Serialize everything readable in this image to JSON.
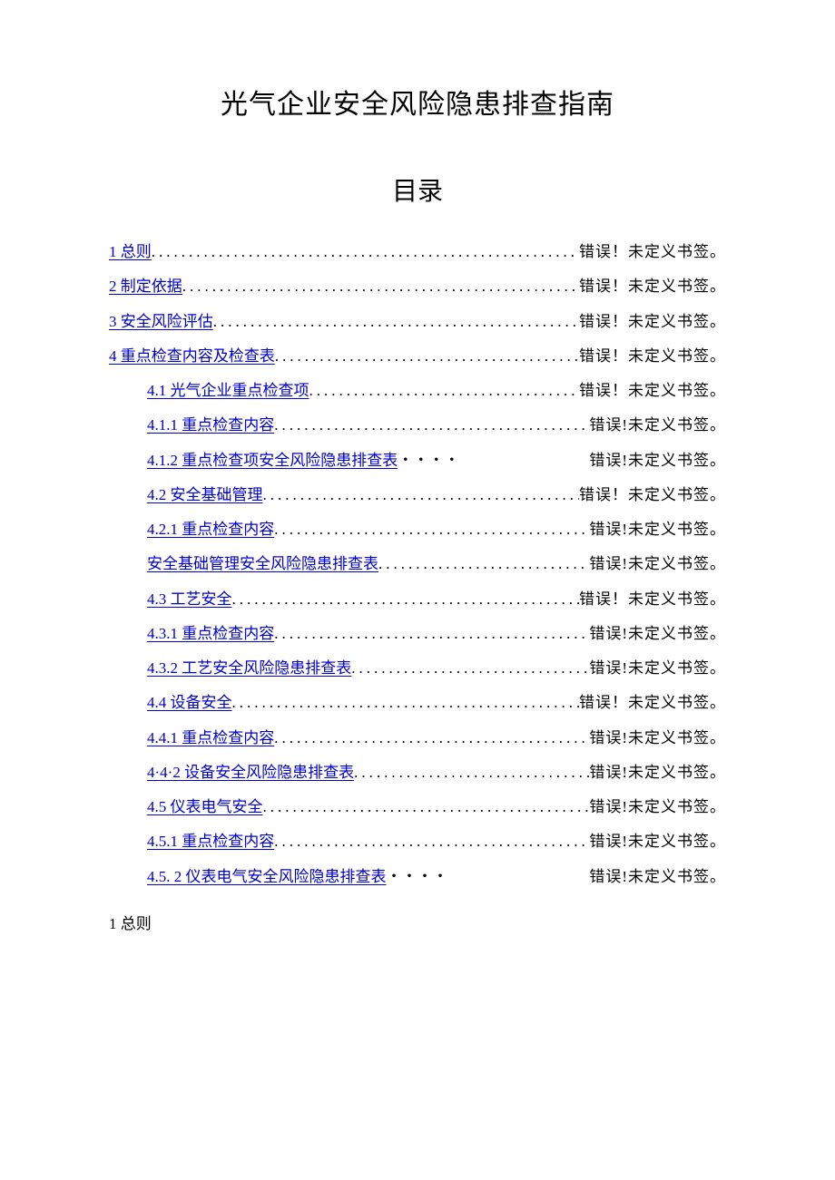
{
  "title": "光气企业安全风险隐患排查指南",
  "toc_title": "目录",
  "error_wide": "错误！未定义书签。",
  "error_narrow": "错误!未定义书签。",
  "toc": [
    {
      "label": "1 总则",
      "level": 0,
      "spaced": true,
      "leader": "dot"
    },
    {
      "label": "2 制定依据",
      "level": 0,
      "spaced": true,
      "leader": "dot"
    },
    {
      "label": "3 安全风险评估",
      "level": 0,
      "spaced": true,
      "leader": "dot"
    },
    {
      "label": "4 重点检查内容及检查表",
      "level": 0,
      "spaced": true,
      "leader": "dot"
    },
    {
      "label": "4.1  光气企业重点检查项",
      "level": 1,
      "spaced": true,
      "leader": "dot"
    },
    {
      "label": "4.1.1  重点检查内容",
      "level": 1,
      "spaced": false,
      "leader": "dot"
    },
    {
      "label": "4.1.2  重点检查项安全风险隐患排查表",
      "level": 1,
      "spaced": false,
      "leader": "cjk"
    },
    {
      "label": "4.2  安全基础管理",
      "level": 1,
      "spaced": true,
      "leader": "dot"
    },
    {
      "label": "4.2.1  重点检查内容",
      "level": 1,
      "spaced": false,
      "leader": "dot"
    },
    {
      "label": "安全基础管理安全风险隐患排查表",
      "level": 1,
      "spaced": false,
      "leader": "dot"
    },
    {
      "label": "4.3  工艺安全",
      "level": 1,
      "spaced": true,
      "leader": "dot"
    },
    {
      "label": "4.3.1  重点检查内容",
      "level": 1,
      "spaced": false,
      "leader": "dot"
    },
    {
      "label": "4.3.2  工艺安全风险隐患排查表",
      "level": 1,
      "spaced": false,
      "leader": "dot"
    },
    {
      "label": "4.4  设备安全",
      "level": 1,
      "spaced": true,
      "leader": "dot"
    },
    {
      "label": "4.4.1  重点检查内容",
      "level": 1,
      "spaced": false,
      "leader": "dot"
    },
    {
      "label": "4·4·2 设备安全风险隐患排查表",
      "level": 1,
      "spaced": false,
      "leader": "dot"
    },
    {
      "label": "4.5  仪表电气安全",
      "level": 1,
      "spaced": false,
      "leader": "dot"
    },
    {
      "label": "4.5.1  重点检查内容",
      "level": 1,
      "spaced": false,
      "leader": "dot"
    },
    {
      "label": "4.5. 2 仪表电气安全风险隐患排查表",
      "level": 1,
      "spaced": false,
      "leader": "cjk"
    }
  ],
  "body_heading": "1 总则"
}
